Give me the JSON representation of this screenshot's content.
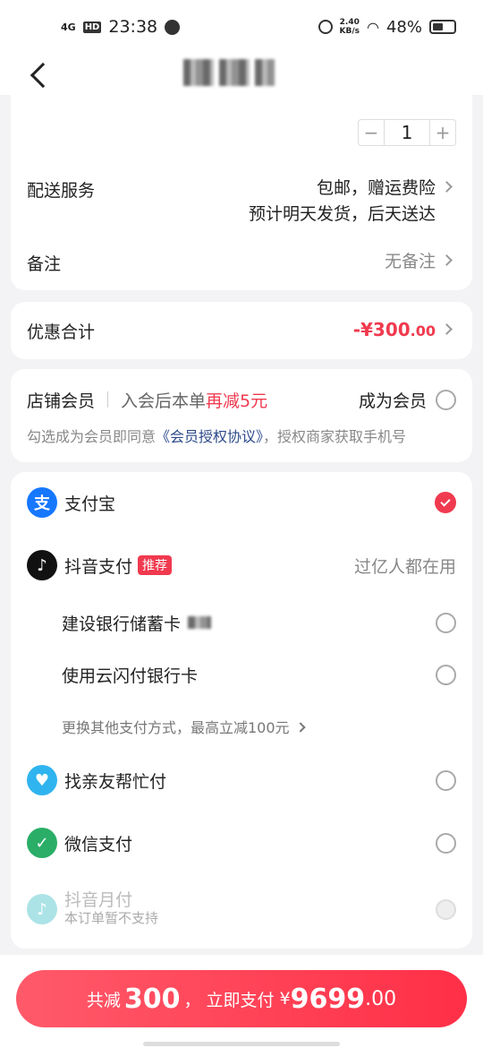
{
  "status_bar": {
    "signal": "4G",
    "hd": "HD",
    "time": "23:38",
    "speed_value": "2.40",
    "speed_unit": "KB/s",
    "battery_pct": "48%"
  },
  "order": {
    "quantity": "1",
    "minus": "−",
    "plus": "+"
  },
  "delivery": {
    "label": "配送服务",
    "line1": "包邮，赠运费险",
    "line2": "预计明天发货，后天送达"
  },
  "remark": {
    "label": "备注",
    "value": "无备注"
  },
  "discount": {
    "label": "优惠合计",
    "amount_main": "-¥300",
    "amount_cents": ".00"
  },
  "membership": {
    "label": "店铺会员",
    "promo_prefix": "入会后本单",
    "promo_highlight": "再减5元",
    "join_label": "成为会员",
    "note_prefix": "勾选成为会员即同意",
    "note_link": "《会员授权协议》",
    "note_suffix": "，授权商家获取手机号"
  },
  "payment": {
    "alipay": {
      "label": "支付宝",
      "icon": "支",
      "selected": true
    },
    "douyin": {
      "label": "抖音支付",
      "badge": "推荐",
      "note": "过亿人都在用",
      "icon": "♪"
    },
    "ccb_card": {
      "label": "建设银行储蓄卡"
    },
    "unionpay": {
      "label": "使用云闪付银行卡"
    },
    "more": {
      "label": "更换其他支付方式，最高立减100元"
    },
    "family": {
      "label": "找亲友帮忙付",
      "icon": "♥"
    },
    "wechat": {
      "label": "微信支付",
      "icon": "✓"
    },
    "monthly": {
      "label": "抖音月付",
      "sub": "本订单暂不支持",
      "icon": "♪"
    }
  },
  "bottom": {
    "saved_prefix": "共减",
    "saved_amount": "300",
    "sep": "，",
    "pay_prefix": "立即支付",
    "currency": "¥",
    "total_main": "9699",
    "total_cents": ".00"
  },
  "colors": {
    "accent": "#f03a4f",
    "alipay": "#1677ff",
    "wechat": "#2aae67",
    "link": "#2b4a8a"
  }
}
